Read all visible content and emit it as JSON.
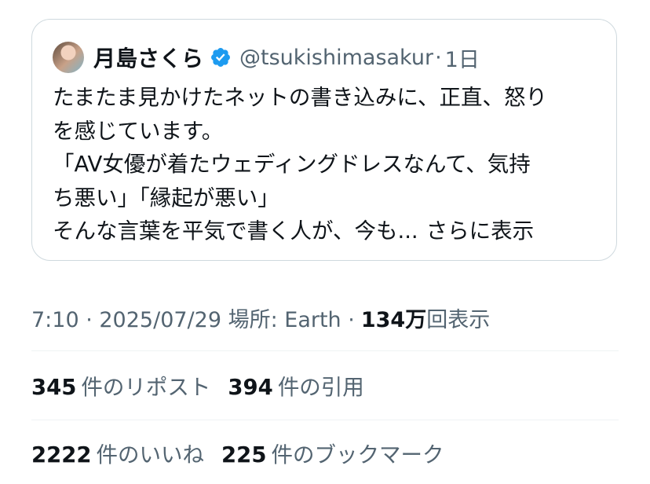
{
  "quote": {
    "display_name": "月島さくら",
    "handle": "@tsukishimasakur",
    "separator": "·",
    "ago": "1日",
    "lines": [
      "たまたま見かけたネットの書き込みに、正直、怒り",
      "を感じています。",
      "「AV女優が着たウェディングドレスなんて、気持",
      "ち悪い」「縁起が悪い」",
      "そんな言葉を平気で書く人が、今も..."
    ],
    "show_more": "さらに表示",
    "verified_icon": "verified-badge-icon",
    "verified_color": "#1d9bf0"
  },
  "meta": {
    "info": "7:10 · 2025/07/29 場所: Earth · ",
    "views_count": "134万",
    "views_label": "回表示"
  },
  "stats": {
    "reposts_count": "345",
    "reposts_label": "件のリポスト",
    "quotes_count": "394",
    "quotes_label": "件の引用",
    "likes_count": "2222",
    "likes_label": "件のいいね",
    "bookmarks_count": "225",
    "bookmarks_label": "件のブックマーク"
  }
}
